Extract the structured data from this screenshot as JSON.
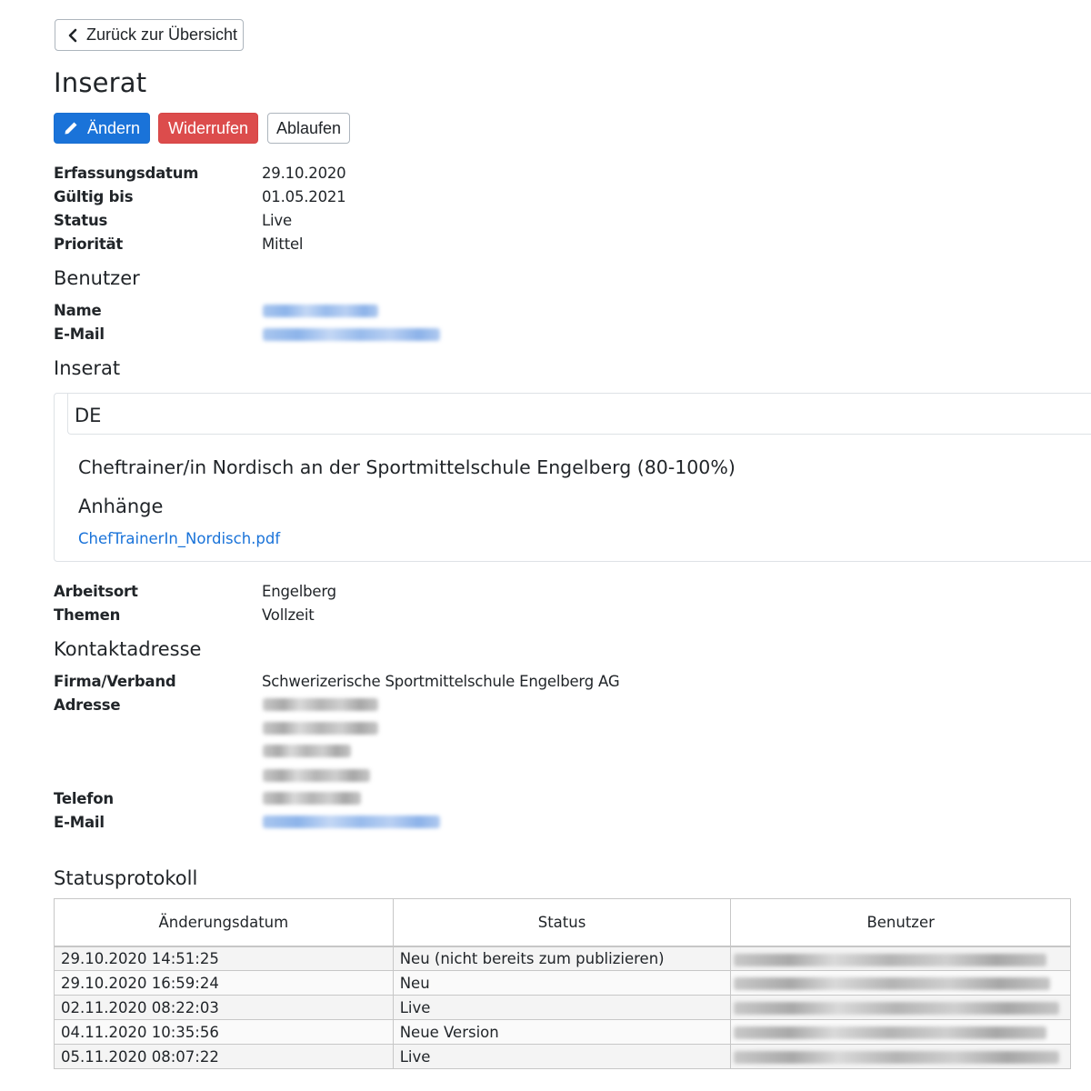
{
  "nav": {
    "back_label": "Zurück zur Übersicht"
  },
  "page": {
    "title": "Inserat"
  },
  "actions": {
    "edit_label": "Ändern",
    "revoke_label": "Widerrufen",
    "expire_label": "Ablaufen"
  },
  "details": [
    {
      "label": "Erfassungsdatum",
      "value": "29.10.2020"
    },
    {
      "label": "Gültig bis",
      "value": "01.05.2021"
    },
    {
      "label": "Status",
      "value": "Live"
    },
    {
      "label": "Priorität",
      "value": "Mittel"
    }
  ],
  "user": {
    "heading": "Benutzer",
    "name_label": "Name",
    "email_label": "E-Mail"
  },
  "listing": {
    "heading": "Inserat",
    "language_tab": "DE",
    "job_title": "Cheftrainer/in Nordisch an der Sportmittelschule Engelberg (80-100%)",
    "attachments_heading": "Anhänge",
    "attachment_link": "ChefTrainerIn_Nordisch.pdf"
  },
  "meta": [
    {
      "label": "Arbeitsort",
      "value": "Engelberg"
    },
    {
      "label": "Themen",
      "value": "Vollzeit"
    }
  ],
  "contact": {
    "heading": "Kontaktadresse",
    "company_label": "Firma/Verband",
    "company_value": "Schwerizerische Sportmittelschule Engelberg AG",
    "address_label": "Adresse",
    "phone_label": "Telefon",
    "email_label": "E-Mail"
  },
  "log": {
    "heading": "Statusprotokoll",
    "columns": [
      "Änderungsdatum",
      "Status",
      "Benutzer"
    ],
    "rows": [
      {
        "date": "29.10.2020 14:51:25",
        "status": "Neu (nicht bereits zum publizieren)"
      },
      {
        "date": "29.10.2020 16:59:24",
        "status": "Neu"
      },
      {
        "date": "02.11.2020 08:22:03",
        "status": "Live"
      },
      {
        "date": "04.11.2020 10:35:56",
        "status": "Neue Version"
      },
      {
        "date": "05.11.2020 08:07:22",
        "status": "Live"
      }
    ]
  },
  "colors": {
    "primary": "#1a73d9",
    "danger": "#dc4c4c",
    "link": "#1a73d9"
  }
}
